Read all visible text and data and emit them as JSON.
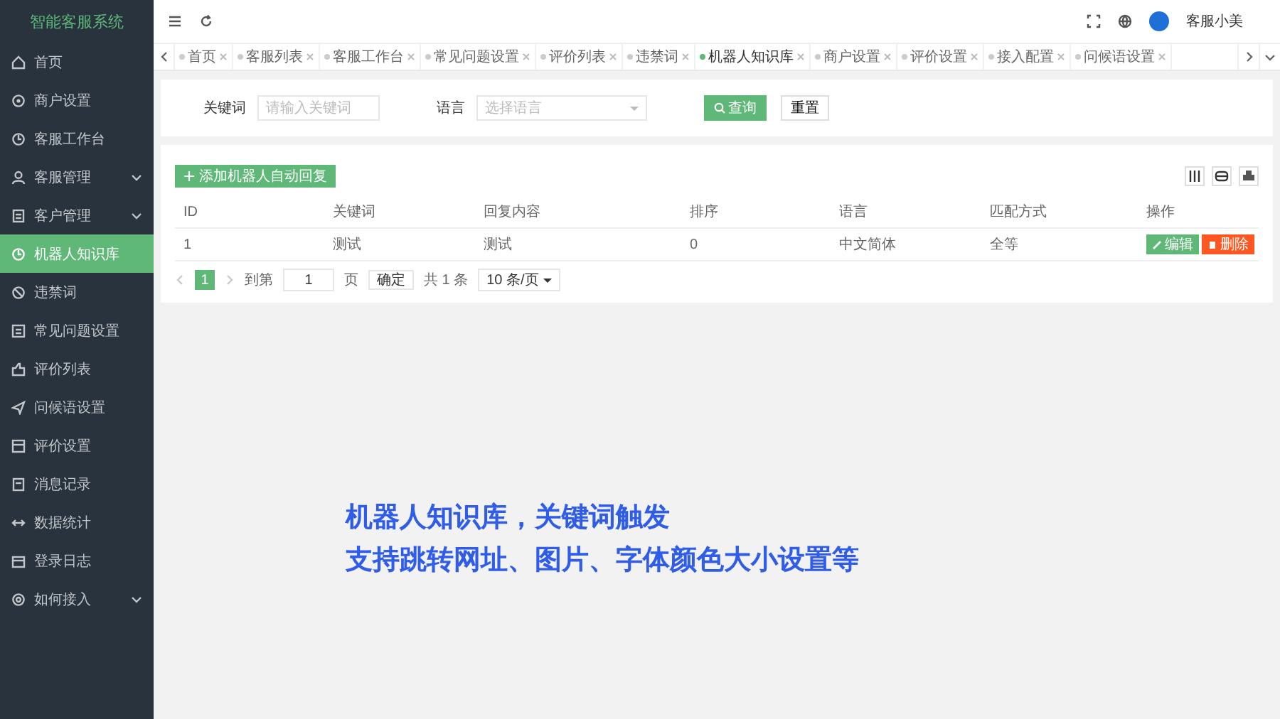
{
  "app": {
    "title": "智能客服系统"
  },
  "sidebar": {
    "items": [
      {
        "label": "首页",
        "expandable": false,
        "selected": false
      },
      {
        "label": "商户设置",
        "expandable": false,
        "selected": false
      },
      {
        "label": "客服工作台",
        "expandable": false,
        "selected": false
      },
      {
        "label": "客服管理",
        "expandable": true,
        "selected": false
      },
      {
        "label": "客户管理",
        "expandable": true,
        "selected": false
      },
      {
        "label": "机器人知识库",
        "expandable": false,
        "selected": true
      },
      {
        "label": "违禁词",
        "expandable": false,
        "selected": false
      },
      {
        "label": "常见问题设置",
        "expandable": false,
        "selected": false
      },
      {
        "label": "评价列表",
        "expandable": false,
        "selected": false
      },
      {
        "label": "问候语设置",
        "expandable": false,
        "selected": false
      },
      {
        "label": "评价设置",
        "expandable": false,
        "selected": false
      },
      {
        "label": "消息记录",
        "expandable": false,
        "selected": false
      },
      {
        "label": "数据统计",
        "expandable": false,
        "selected": false
      },
      {
        "label": "登录日志",
        "expandable": false,
        "selected": false
      },
      {
        "label": "如何接入",
        "expandable": true,
        "selected": false
      }
    ]
  },
  "header": {
    "user": "客服小美"
  },
  "tabs": [
    {
      "label": "首页",
      "selected": false
    },
    {
      "label": "客服列表",
      "selected": false
    },
    {
      "label": "客服工作台",
      "selected": false
    },
    {
      "label": "常见问题设置",
      "selected": false
    },
    {
      "label": "评价列表",
      "selected": false
    },
    {
      "label": "违禁词",
      "selected": false
    },
    {
      "label": "机器人知识库",
      "selected": true
    },
    {
      "label": "商户设置",
      "selected": false
    },
    {
      "label": "评价设置",
      "selected": false
    },
    {
      "label": "接入配置",
      "selected": false
    },
    {
      "label": "问候语设置",
      "selected": false
    }
  ],
  "search": {
    "fields": [
      {
        "label": "关键词",
        "kind": "text",
        "placeholder": "请输入关键词"
      },
      {
        "label": "语言",
        "kind": "select",
        "placeholder": "选择语言"
      }
    ],
    "buttons": [
      {
        "label": "查询",
        "kind": "primary"
      },
      {
        "label": "重置",
        "kind": "plain"
      }
    ]
  },
  "table": {
    "add_button": "添加机器人自动回复",
    "columns": [
      "ID",
      "关键词",
      "回复内容",
      "排序",
      "语言",
      "匹配方式",
      "操作"
    ],
    "rows": [
      {
        "cells": [
          "1",
          "测试",
          "测试",
          "0",
          "中文简体",
          "全等"
        ],
        "actions": [
          {
            "label": "编辑",
            "kind": "edit"
          },
          {
            "label": "删除",
            "kind": "delete"
          }
        ]
      }
    ]
  },
  "pagination": {
    "pages": [
      {
        "label": "1",
        "selected": true
      }
    ],
    "goto_label": "到第",
    "goto_value": "1",
    "page_unit": "页",
    "confirm": "确定",
    "total": "共 1 条",
    "page_size": "10 条/页"
  },
  "caption": [
    "机器人知识库，关键词触发",
    "支持跳转网址、图片、字体颜色大小设置等"
  ]
}
